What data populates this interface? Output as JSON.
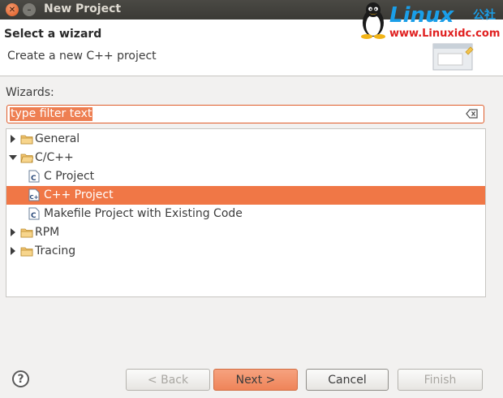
{
  "window": {
    "title": "New Project"
  },
  "header": {
    "title": "Select a wizard",
    "description": "Create a new C++ project"
  },
  "watermark": {
    "brand": "Linux",
    "brand_cn": "公社",
    "url": "www.Linuxidc.com"
  },
  "wizards": {
    "label": "Wizards:",
    "filter_value": "type filter text"
  },
  "tree": {
    "items": [
      {
        "label": "General",
        "level": 0,
        "kind": "folder",
        "expanded": false
      },
      {
        "label": "C/C++",
        "level": 0,
        "kind": "folder",
        "expanded": true
      },
      {
        "label": "C Project",
        "level": 1,
        "kind": "file",
        "badge": "C"
      },
      {
        "label": "C++ Project",
        "level": 1,
        "kind": "file",
        "badge": "C++",
        "selected": true
      },
      {
        "label": "Makefile Project with Existing Code",
        "level": 1,
        "kind": "file",
        "badge": "C"
      },
      {
        "label": "RPM",
        "level": 0,
        "kind": "folder",
        "expanded": false
      },
      {
        "label": "Tracing",
        "level": 0,
        "kind": "folder",
        "expanded": false
      }
    ]
  },
  "buttons": {
    "help": "?",
    "back": "< Back",
    "next": "Next >",
    "cancel": "Cancel",
    "finish": "Finish"
  },
  "colors": {
    "selection": "#f07746",
    "filter_border": "#e05c2a",
    "titlebar": "#3b3a36"
  }
}
